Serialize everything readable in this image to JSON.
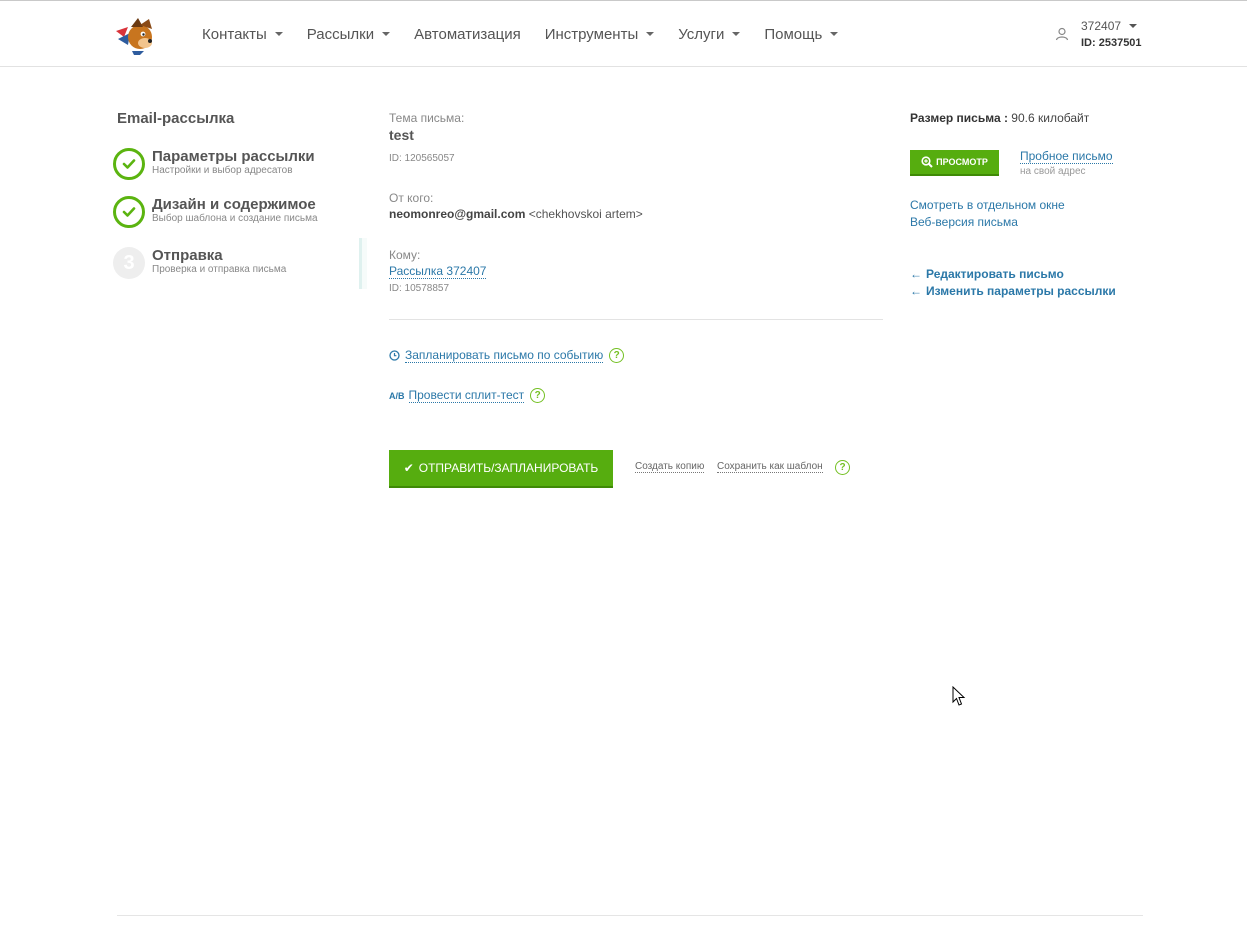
{
  "header": {
    "nav": [
      {
        "label": "Контакты",
        "caret": true
      },
      {
        "label": "Рассылки",
        "caret": true
      },
      {
        "label": "Автоматизация",
        "caret": false
      },
      {
        "label": "Инструменты",
        "caret": true
      },
      {
        "label": "Услуги",
        "caret": true
      },
      {
        "label": "Помощь",
        "caret": true
      }
    ],
    "user": {
      "name": "372407",
      "id": "ID: 2537501"
    }
  },
  "sidebar": {
    "title": "Email-рассылка",
    "steps": [
      {
        "title": "Параметры рассылки",
        "subtitle": "Настройки и выбор адресатов",
        "status": "done"
      },
      {
        "title": "Дизайн и содержимое",
        "subtitle": "Выбор шаблона и создание письма",
        "status": "done"
      },
      {
        "number": "3",
        "title": "Отправка",
        "subtitle": "Проверка и отправка письма",
        "status": "active"
      }
    ]
  },
  "main": {
    "subject_label": "Тема письма:",
    "subject": "test",
    "subject_id": "ID: 120565057",
    "from_label": "От кого:",
    "from_email": "neomonreo@gmail.com",
    "from_name": "<chekhovskoi artem>",
    "to_label": "Кому:",
    "to_list": "Рассылка 372407",
    "to_id": "ID: 10578857",
    "schedule_event": "Запланировать письмо по событию",
    "split_test": "Провести сплит-тест",
    "ab_icon": "A/B",
    "help_mark": "?",
    "send_button": "ОТПРАВИТЬ/ЗАПЛАНИРОВАТЬ",
    "create_copy": "Создать копию",
    "save_template": "Сохранить как шаблон"
  },
  "right": {
    "size_label": "Размер письма :",
    "size_value": "90.6 килобайт",
    "preview_button": "ПРОСМОТР",
    "trial_email": "Пробное письмо",
    "trial_sub": "на свой адрес",
    "open_window": "Смотреть в отдельном окне",
    "web_version": "Веб-версия письма",
    "edit_email": "Редактировать письмо",
    "change_params": "Изменить параметры рассылки"
  },
  "colors": {
    "accent_green": "#56ad0f",
    "link_blue": "#2b78a8",
    "help_green": "#74c023"
  }
}
